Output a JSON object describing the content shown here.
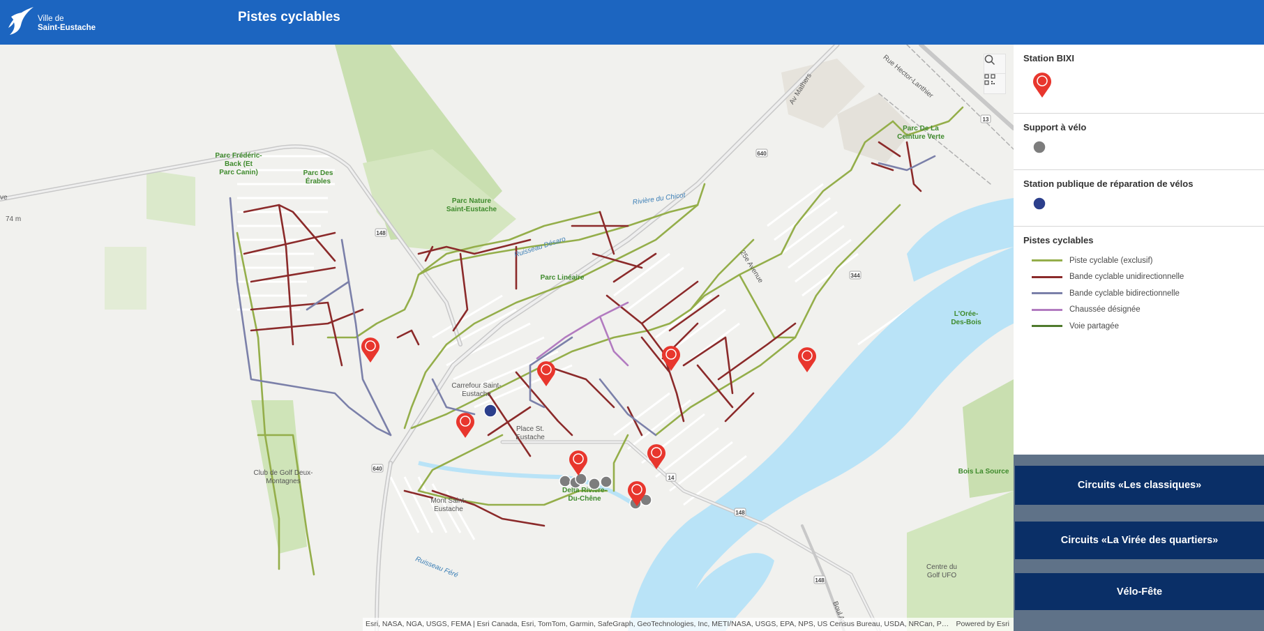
{
  "header": {
    "logo_line1": "Ville de",
    "logo_line2": "Saint-Eustache",
    "title": "Pistes cyclables",
    "background": "#1c65c0"
  },
  "map": {
    "tools": [
      {
        "name": "search-button",
        "icon": "search-icon"
      },
      {
        "name": "qr-code-button",
        "icon": "qr-code-icon"
      }
    ],
    "attribution": "Esri, NASA, NGA, USGS, FEMA | Esri Canada, Esri, TomTom, Garmin, SafeGraph, GeoTechnologies, Inc, METI/NASA, USGS, EPA, NPS, US Census Bureau, USDA, NRCan, Pa...",
    "powered_by": "Powered by Esri",
    "labels": {
      "parc_frederic": [
        "Parc Frédéric-",
        "Back (Et",
        "Parc Canin)"
      ],
      "parc_erables": [
        "Parc Des",
        "Érables"
      ],
      "parc_nature": [
        "Parc Nature",
        "Saint-Eustache"
      ],
      "parc_lineaire": "Parc Linéaire",
      "parc_ceinture": [
        "Parc De La",
        "Ceinture Verte"
      ],
      "riviere_chicot": "Rivière du Chicot",
      "ruisseau_desaro": "Ruisseau Désaro",
      "ruisseau_fere": "Ruisseau Féré",
      "carrefour": [
        "Carrefour Saint-",
        "Eustache"
      ],
      "place_st": [
        "Place St.",
        "Eustache"
      ],
      "club_golf": [
        "Club de Golf Deux-",
        "Montagnes"
      ],
      "mont_saint": [
        "Mont Saint-",
        "Eustache"
      ],
      "delta": [
        "Delta Rivière-",
        "Du-Chêne"
      ],
      "oree_bois": [
        "L'Orée-",
        "Des-Bois"
      ],
      "bois_source": "Bois La Source",
      "centre_golf": [
        "Centre du",
        "Golf UFO"
      ],
      "av_mathers": "Av Mathers",
      "rue_hector": "Rue Hector-Lanthier",
      "av_25e": "25e Avenue",
      "boul_arthur": "Boul Ar",
      "elev": "74 m",
      "ave_frag": "ve",
      "r148a": "148",
      "r148b": "148",
      "r148c": "148",
      "r640a": "640",
      "r640b": "640",
      "r344": "344",
      "r13": "13",
      "r14": "14"
    }
  },
  "legend": {
    "sections": [
      {
        "title": "Station BIXI",
        "icon": "bike-station-pin-icon"
      },
      {
        "title": "Support à vélo",
        "icon": "bike-rack-icon"
      },
      {
        "title": "Station publique de réparation de vélos",
        "icon": "repair-station-icon"
      }
    ],
    "lines_title": "Pistes cyclables",
    "lines": [
      {
        "label": "Piste cyclable (exclusif)",
        "color": "#94ae4a"
      },
      {
        "label": "Bande cyclable unidirectionnelle",
        "color": "#8b2a2a"
      },
      {
        "label": "Bande cyclable bidirectionnelle",
        "color": "#7b80a9"
      },
      {
        "label": "Chaussée désignée",
        "color": "#b27bc0"
      },
      {
        "label": "Voie partagée",
        "color": "#4f7a2d"
      }
    ]
  },
  "buttons": [
    {
      "label": "Circuits «Les classiques»"
    },
    {
      "label": "Circuits «La Virée des quartiers»"
    },
    {
      "label": "Vélo-Fête"
    }
  ],
  "colors": {
    "button_bg": "#0a2f67",
    "pin_red": "#e8362d",
    "repair_blue": "#2c3f8c",
    "rack_grey": "#7d7d7d",
    "water": "#b9e3f7"
  }
}
